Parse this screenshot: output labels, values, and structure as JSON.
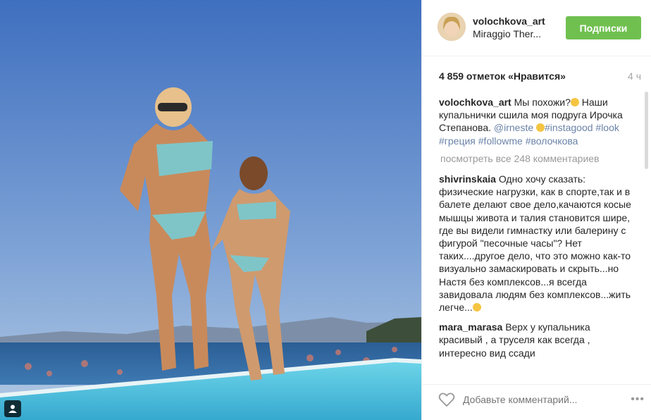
{
  "post": {
    "username": "volochkova_art",
    "location": "Miraggio Ther...",
    "follow_label": "Подписки",
    "likes": "4 859 отметок «Нравится»",
    "time": "4 ч",
    "caption": {
      "author": "volochkova_art",
      "text": "Мы похожи?",
      "text2": " Наши купальнички сшила моя подруга Ирочка Степанова. ",
      "mention": "@irneste",
      "tags": "#instagood #look #греция #followme #волочкова"
    },
    "view_all": "посмотреть все 248 комментариев",
    "comments": [
      {
        "author": "shivrinskaia",
        "text": "Одно хочу сказать: физические нагрузки, как в спорте,так и в балете делают свое дело,качаются косые мышцы живота и талия становится шире, где вы видели гимнастку или балерину с фигурой \"песочные часы\"? Нет таких....другое дело, что это можно как-то визуально замаскировать и скрыть...но Настя без комплексов...я всегда завидовала людям без комплексов...жить легче..."
      },
      {
        "author": "mara_marasa",
        "text": "Верх у купальника красивый , а труселя как всегда , интересно вид ссади"
      }
    ],
    "add_comment_placeholder": "Добавьте комментарий...",
    "more_label": "•••"
  },
  "colors": {
    "follow": "#70c050",
    "link": "#6a83a8",
    "muted": "#999999"
  }
}
